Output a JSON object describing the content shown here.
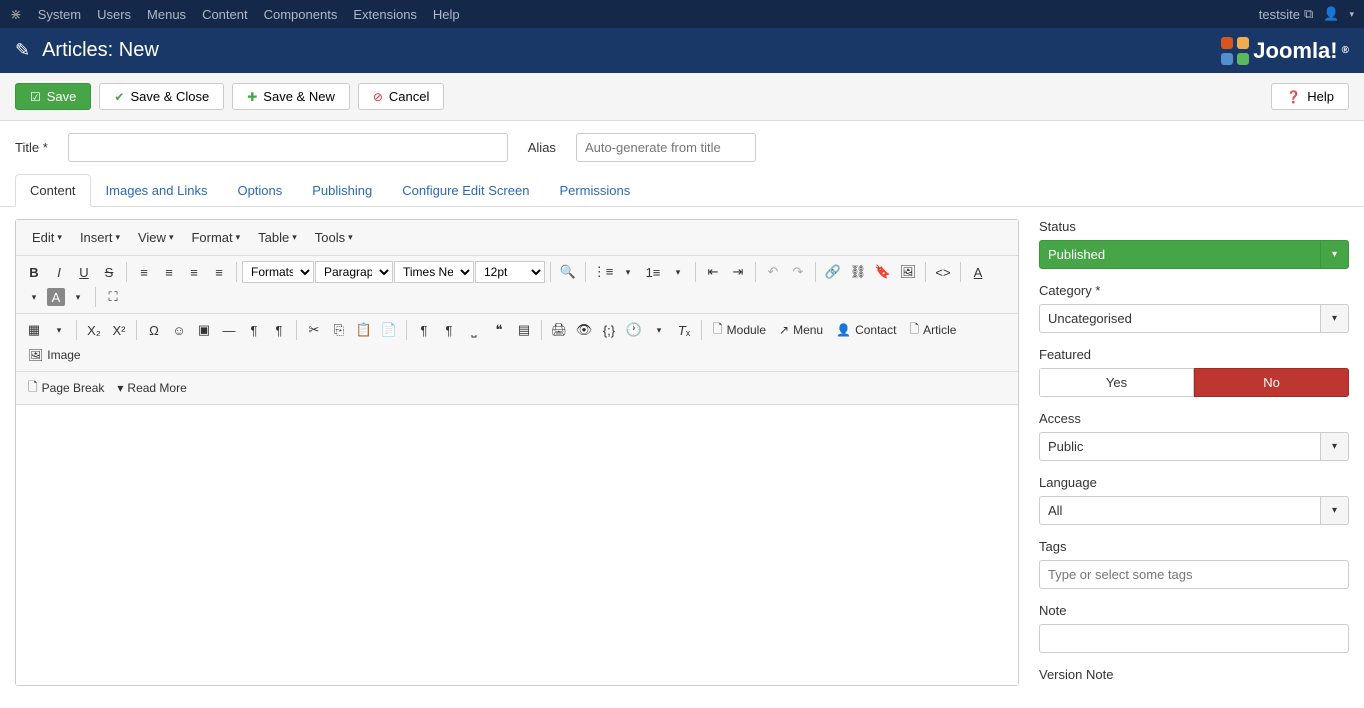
{
  "adminbar": {
    "menus": [
      "System",
      "Users",
      "Menus",
      "Content",
      "Components",
      "Extensions",
      "Help"
    ],
    "site": "testsite"
  },
  "header": {
    "title": "Articles: New",
    "brand": "Joomla!"
  },
  "toolbar": {
    "save": "Save",
    "save_close": "Save & Close",
    "save_new": "Save & New",
    "cancel": "Cancel",
    "help": "Help"
  },
  "form": {
    "title_label": "Title *",
    "alias_label": "Alias",
    "alias_placeholder": "Auto-generate from title"
  },
  "tabs": [
    "Content",
    "Images and Links",
    "Options",
    "Publishing",
    "Configure Edit Screen",
    "Permissions"
  ],
  "editor": {
    "menubar": [
      "Edit",
      "Insert",
      "View",
      "Format",
      "Table",
      "Tools"
    ],
    "formats": "Formats",
    "paragraph": "Paragraph",
    "font": "Times Ne...",
    "fontsize": "12pt",
    "module": "Module",
    "menu": "Menu",
    "contact": "Contact",
    "article": "Article",
    "image": "Image",
    "pagebreak": "Page Break",
    "readmore": "Read More"
  },
  "sidebar": {
    "status_label": "Status",
    "status_value": "Published",
    "category_label": "Category *",
    "category_value": "Uncategorised",
    "featured_label": "Featured",
    "featured_yes": "Yes",
    "featured_no": "No",
    "access_label": "Access",
    "access_value": "Public",
    "language_label": "Language",
    "language_value": "All",
    "tags_label": "Tags",
    "tags_placeholder": "Type or select some tags",
    "note_label": "Note",
    "version_label": "Version Note"
  }
}
